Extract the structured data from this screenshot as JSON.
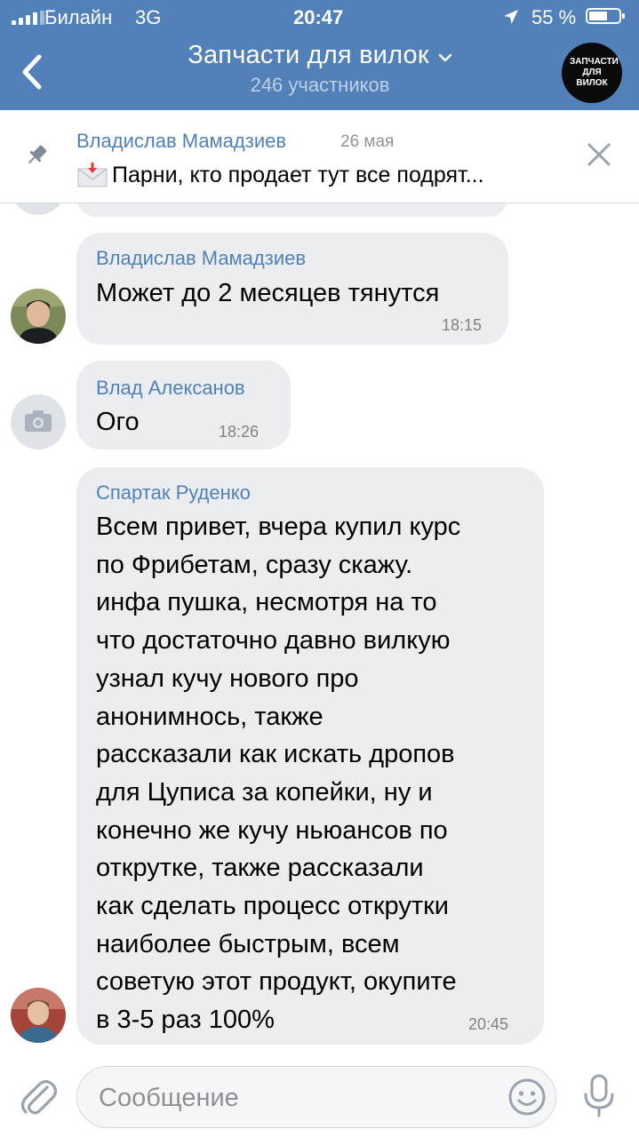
{
  "status_bar": {
    "carrier": "Билайн",
    "network": "3G",
    "time": "20:47",
    "battery": "55 %"
  },
  "header": {
    "title": "Запчасти для вилок",
    "subtitle": "246 участников",
    "avatar_text": "ЗАПЧАСТИ ДЛЯ ВИЛОК"
  },
  "pinned": {
    "author": "Владислав Мамадзиев",
    "date": "26 мая",
    "text": "Парни, кто продает тут все подрят..."
  },
  "messages": [
    {
      "sender": "Владислав Мамадзиев",
      "text": "Может до 2 месяцев тянутся",
      "time": "18:15"
    },
    {
      "sender": "Влад Алексанов",
      "text": "Ого",
      "time": "18:26"
    },
    {
      "sender": "Спартак Руденко",
      "lines": [
        "Всем привет, вчера купил курс",
        "по Фрибетам, сразу скажу.",
        "инфа пушка, несмотря на то",
        "что достаточно давно вилкую",
        "узнал кучу нового про",
        "анонимнось, также",
        "рассказали как искать дропов",
        "для Цуписа за копейки, ну и",
        "конечно же кучу ньюансов по",
        "открутке, также рассказали",
        "как сделать процесс открутки",
        "наиболее быстрым, всем",
        "советую этот продукт, окупите",
        "в 3-5 раз 100%"
      ],
      "time": "20:45"
    }
  ],
  "composer": {
    "placeholder": "Сообщение"
  },
  "colors": {
    "header_bg": "#5181b8",
    "link": "#5181b8",
    "bubble": "#ebedf0"
  }
}
